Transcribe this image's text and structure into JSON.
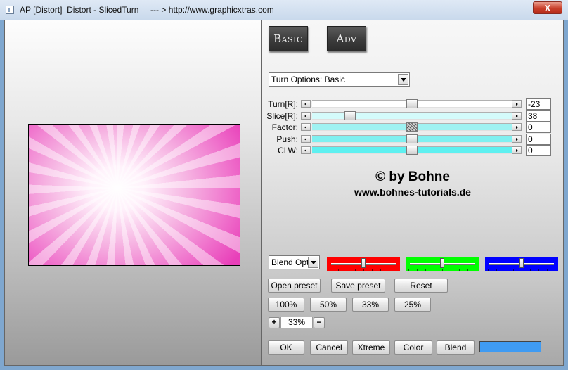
{
  "window": {
    "title": "AP [Distort]  Distort - SlicedTurn     --- > http://www.graphicxtras.com",
    "close_label": "X"
  },
  "mode_buttons": {
    "basic": "Basic",
    "adv": "Adv"
  },
  "turn_options": {
    "selected": "Turn Options: Basic"
  },
  "sliders": [
    {
      "label": "Turn[R]:",
      "value": "-23",
      "position": 0.5,
      "track_color": "#ffffff"
    },
    {
      "label": "Slice[R]:",
      "value": "38",
      "position": 0.19,
      "track_color": "#d4fbfb"
    },
    {
      "label": "Factor:",
      "value": "0",
      "position": 0.5,
      "track_color": "#9ff2f2"
    },
    {
      "label": "Push:",
      "value": "0",
      "position": 0.5,
      "track_color": "#7ff0f0"
    },
    {
      "label": "CLW:",
      "value": "0",
      "position": 0.5,
      "track_color": "#5ef0f0"
    }
  ],
  "credits": {
    "copyright": "© by Bohne",
    "url": "www.bohnes-tutorials.de"
  },
  "blend_options": {
    "selected": "Blend Optic"
  },
  "color_sliders": [
    {
      "name": "red",
      "color": "#ff0000",
      "position": 0.5
    },
    {
      "name": "green",
      "color": "#00ff00",
      "position": 0.5
    },
    {
      "name": "blue",
      "color": "#0000ff",
      "position": 0.5
    }
  ],
  "preset_buttons": {
    "open": "Open preset",
    "save": "Save preset",
    "reset": "Reset"
  },
  "zoom_buttons": [
    "100%",
    "50%",
    "33%",
    "25%"
  ],
  "zoom_stepper": {
    "plus": "+",
    "value": "33%",
    "minus": "−"
  },
  "action_buttons": {
    "ok": "OK",
    "cancel": "Cancel",
    "xtreme": "Xtreme",
    "color": "Color",
    "blend": "Blend"
  },
  "blend_color": "#3f9bf3",
  "colors": {
    "preview_center": "#ffffff",
    "preview_edge": "#e83fb9"
  }
}
